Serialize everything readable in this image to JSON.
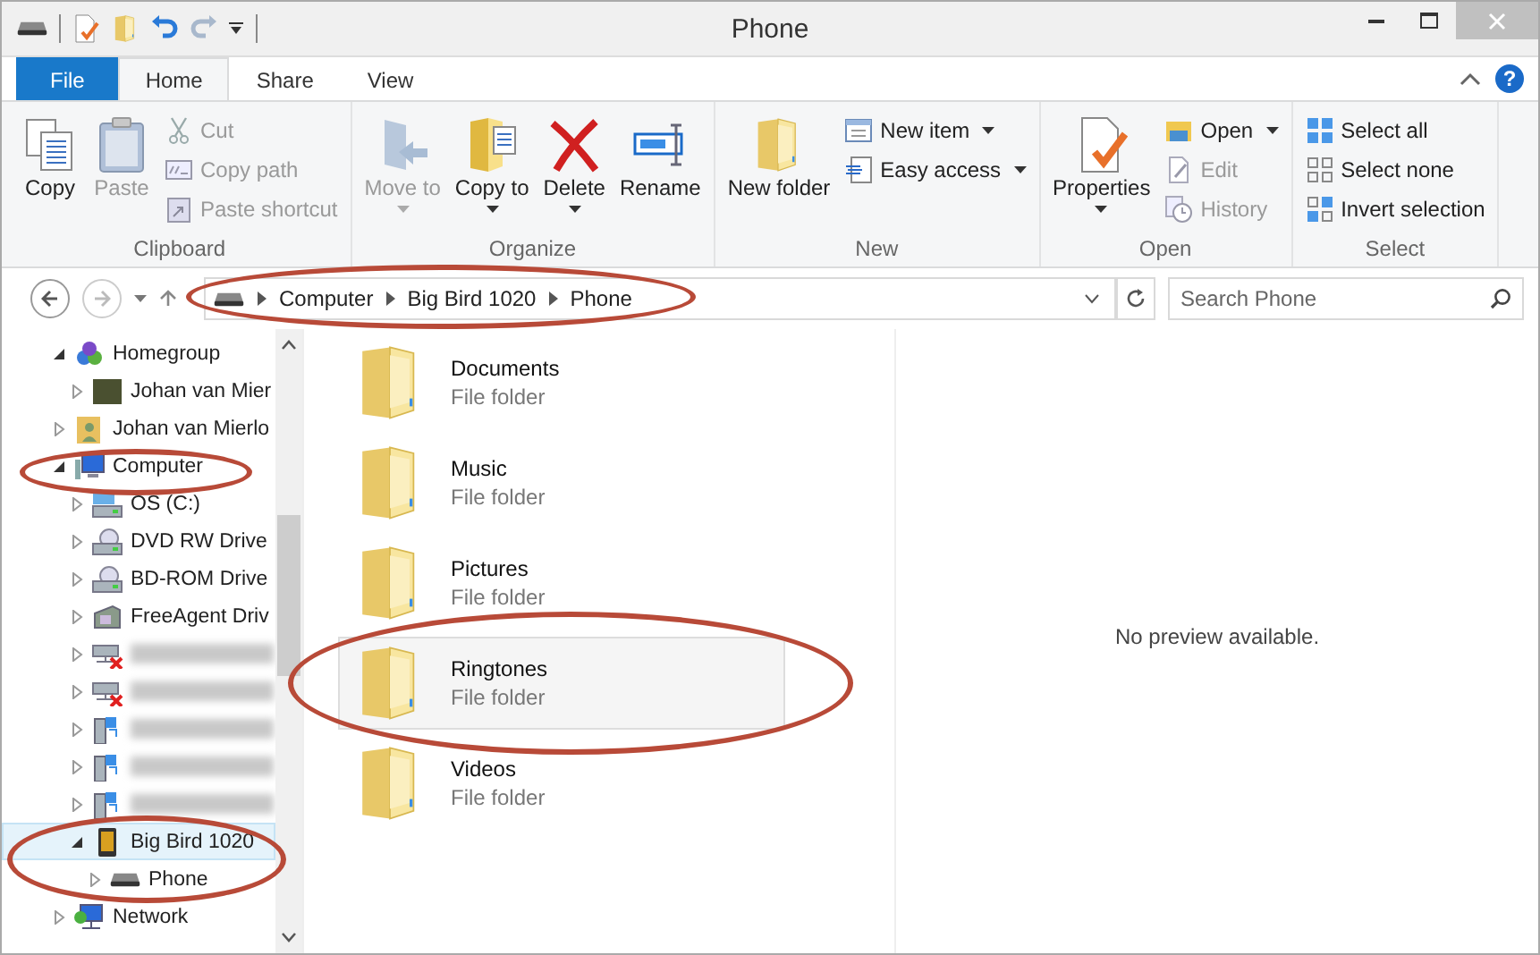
{
  "window": {
    "title": "Phone"
  },
  "ribbon_tabs": [
    {
      "label": "File",
      "kind": "file",
      "selected": false
    },
    {
      "label": "Home",
      "kind": "tab",
      "selected": true
    },
    {
      "label": "Share",
      "kind": "tab",
      "selected": false
    },
    {
      "label": "View",
      "kind": "tab",
      "selected": false
    }
  ],
  "help_button": {
    "label": "?"
  },
  "ribbon_groups": [
    {
      "label": "Clipboard",
      "items": [
        {
          "kind": "large",
          "label": "Copy",
          "disabled": false,
          "dropdown": false
        },
        {
          "kind": "large",
          "label": "Paste",
          "disabled": true,
          "dropdown": false
        },
        {
          "kind": "small",
          "label": "Cut",
          "disabled": true,
          "dropdown": false
        },
        {
          "kind": "small",
          "label": "Copy path",
          "disabled": true,
          "dropdown": false
        },
        {
          "kind": "small",
          "label": "Paste shortcut",
          "disabled": true,
          "dropdown": false
        }
      ]
    },
    {
      "label": "Organize",
      "items": [
        {
          "kind": "large",
          "label": "Move to",
          "disabled": true,
          "dropdown": true
        },
        {
          "kind": "large",
          "label": "Copy to",
          "disabled": false,
          "dropdown": true
        },
        {
          "kind": "large",
          "label": "Delete",
          "disabled": false,
          "dropdown": true
        },
        {
          "kind": "large",
          "label": "Rename",
          "disabled": false,
          "dropdown": false
        }
      ]
    },
    {
      "label": "New",
      "items": [
        {
          "kind": "large",
          "label": "New folder",
          "disabled": false,
          "dropdown": false
        },
        {
          "kind": "small",
          "label": "New item",
          "disabled": false,
          "dropdown": true
        },
        {
          "kind": "small",
          "label": "Easy access",
          "disabled": false,
          "dropdown": true
        }
      ]
    },
    {
      "label": "Open",
      "items": [
        {
          "kind": "large",
          "label": "Properties",
          "disabled": false,
          "dropdown": true
        },
        {
          "kind": "small",
          "label": "Open",
          "disabled": false,
          "dropdown": true
        },
        {
          "kind": "small",
          "label": "Edit",
          "disabled": true,
          "dropdown": false
        },
        {
          "kind": "small",
          "label": "History",
          "disabled": true,
          "dropdown": false
        }
      ]
    },
    {
      "label": "Select",
      "items": [
        {
          "kind": "small",
          "label": "Select all",
          "disabled": false,
          "dropdown": false
        },
        {
          "kind": "small",
          "label": "Select none",
          "disabled": false,
          "dropdown": false
        },
        {
          "kind": "small",
          "label": "Invert selection",
          "disabled": false,
          "dropdown": false
        }
      ]
    }
  ],
  "address_bar": {
    "breadcrumbs": [
      "Computer",
      "Big Bird 1020",
      "Phone"
    ]
  },
  "search": {
    "placeholder": "Search Phone"
  },
  "nav_tree": [
    {
      "kind": "homegroup",
      "label": "Homegroup",
      "expanded": true,
      "selected": false,
      "children": [
        {
          "kind": "person",
          "label": "Johan van Mier",
          "expanded": false,
          "selected": false
        }
      ]
    },
    {
      "kind": "user-folder",
      "label": "Johan van Mierlo",
      "expanded": false,
      "selected": false
    },
    {
      "kind": "computer",
      "label": "Computer",
      "expanded": true,
      "selected": false,
      "children": [
        {
          "kind": "disk",
          "label": "OS (C:)",
          "expanded": false,
          "selected": false
        },
        {
          "kind": "optical",
          "label": "DVD RW Drive",
          "expanded": false,
          "selected": false
        },
        {
          "kind": "optical",
          "label": "BD-ROM Drive",
          "expanded": false,
          "selected": false
        },
        {
          "kind": "external",
          "label": "FreeAgent Driv",
          "expanded": false,
          "selected": false
        },
        {
          "kind": "offline-drive",
          "expanded": false,
          "selected": false
        },
        {
          "kind": "offline-drive",
          "expanded": false,
          "selected": false
        },
        {
          "kind": "network-drive",
          "expanded": false,
          "selected": false
        },
        {
          "kind": "network-drive",
          "expanded": false,
          "selected": false
        },
        {
          "kind": "network-drive",
          "expanded": false,
          "selected": false
        },
        {
          "kind": "phone",
          "label": "Big Bird 1020",
          "expanded": true,
          "selected": true,
          "children": [
            {
              "kind": "storage",
              "label": "Phone",
              "expanded": false,
              "selected": false
            }
          ]
        }
      ]
    },
    {
      "kind": "network",
      "label": "Network",
      "expanded": false,
      "selected": false
    }
  ],
  "files": [
    {
      "name": "Documents",
      "type": "File folder",
      "selected": false
    },
    {
      "name": "Music",
      "type": "File folder",
      "selected": false
    },
    {
      "name": "Pictures",
      "type": "File folder",
      "selected": false
    },
    {
      "name": "Ringtones",
      "type": "File folder",
      "selected": true
    },
    {
      "name": "Videos",
      "type": "File folder",
      "selected": false
    }
  ],
  "preview": {
    "message": "No preview available."
  }
}
